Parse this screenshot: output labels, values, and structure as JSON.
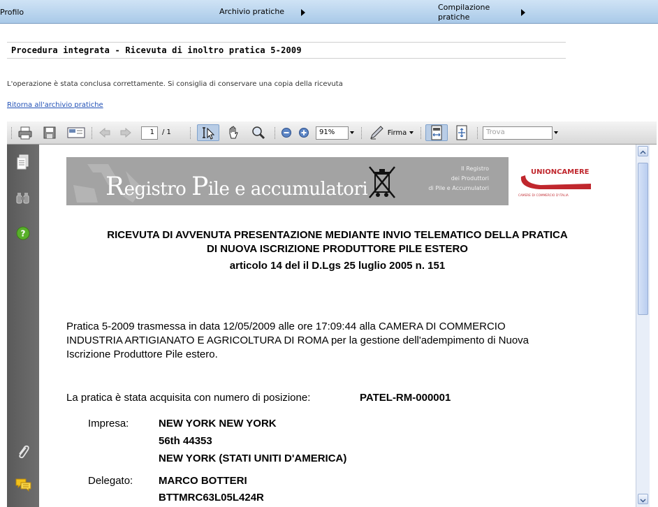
{
  "menu": {
    "profile": "Profilo",
    "archive": "Archivio pratiche",
    "compile_line1": "Compilazione",
    "compile_line2": "pratiche"
  },
  "page": {
    "heading": "Procedura integrata - Ricevuta di inoltro pratica 5-2009",
    "notice": "L'operazione è stata conclusa correttamente. Si consiglia di conservare una copia della ricevuta",
    "back_link": "Ritorna all'archivio pratiche"
  },
  "toolbar": {
    "page_current": "1",
    "page_total": "/ 1",
    "zoom": "91%",
    "sign_label": "Firma",
    "find_placeholder": "Trova"
  },
  "document": {
    "banner_title_R": "R",
    "banner_title_1": "egistro ",
    "banner_title_P": "P",
    "banner_title_2": "ile e accumulatori",
    "banner_right_1": "Il Registro",
    "banner_right_2": "dei Produttori",
    "banner_right_3": "di  Pile e Accumulatori",
    "union_name": "UNIONCAMERE",
    "union_sub": "CAMERE DI COMMERCIO D'ITALIA",
    "title_line1": "RICEVUTA DI AVVENUTA PRESENTAZIONE MEDIANTE INVIO TELEMATICO DELLA PRATICA",
    "title_line2": "DI NUOVA ISCRIZIONE PRODUTTORE PILE ESTERO",
    "title_line3": "articolo 14 del il D.Lgs 25 luglio 2005 n. 151",
    "para_line1": "Pratica 5-2009 trasmessa in data 12/05/2009 alle ore 17:09:44 alla CAMERA DI COMMERCIO",
    "para_line2": "INDUSTRIA ARTIGIANATO E AGRICOLTURA DI ROMA per la gestione dell'adempimento di Nuova",
    "para_line3": "Iscrizione Produttore Pile estero.",
    "position_label": "La pratica è stata acquisita con numero di posizione:",
    "position_value": "PATEL-RM-000001",
    "company_label": "Impresa:",
    "company_name": "NEW YORK NEW YORK",
    "company_address": "56th 44353",
    "company_city": "NEW YORK (STATI UNITI D'AMERICA)",
    "delegate_label": "Delegato:",
    "delegate_name": "MARCO BOTTERI",
    "delegate_code": "BTTMRC63L05L424R"
  },
  "colors": {
    "menubar": "#a9c9e8",
    "link": "#1f4fb5",
    "sidepanel": "#5a5a5a",
    "union_red": "#c0272d",
    "banner_gray": "#a3a3a3"
  }
}
